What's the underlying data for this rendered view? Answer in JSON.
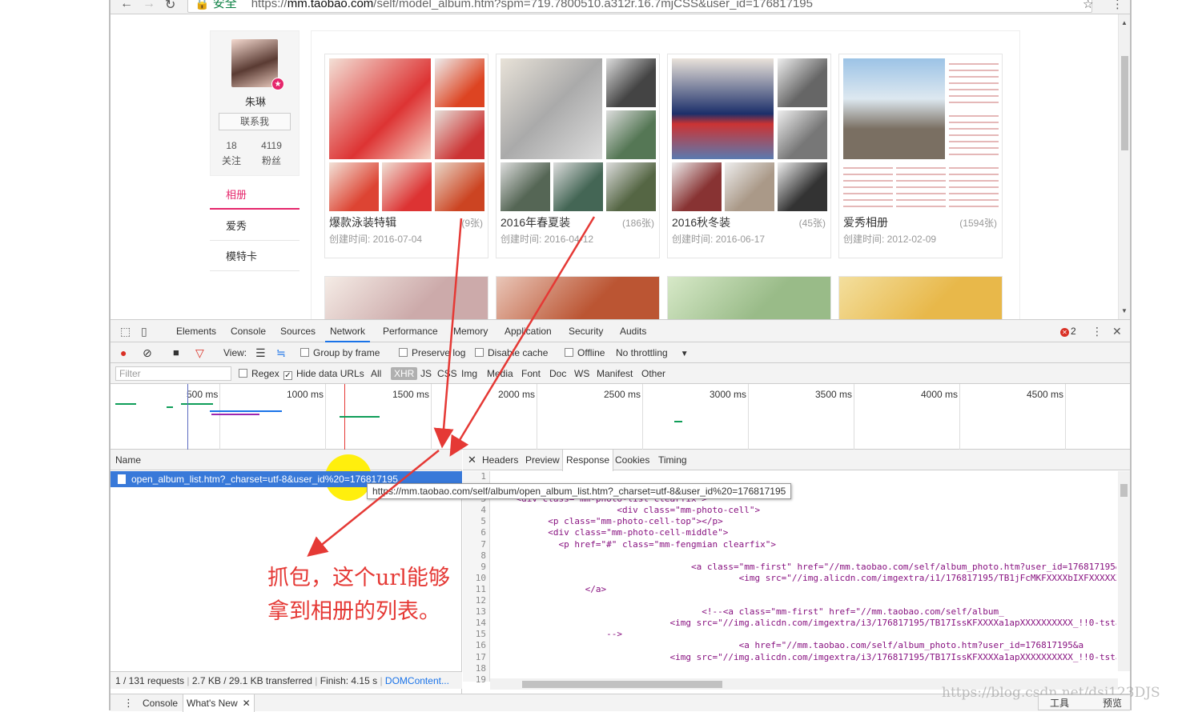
{
  "browser": {
    "url_secure_label": "安全",
    "url_scheme": "https://",
    "url_host": "mm.taobao.com",
    "url_path": "/self/model_album.htm?spm=719.7800510.a312r.16.7mjCSS&user_id=176817195"
  },
  "profile": {
    "name": "朱琳",
    "contact_label": "联系我",
    "following_count": "18",
    "following_label": "关注",
    "fans_count": "4119",
    "fans_label": "粉丝"
  },
  "sidebar": {
    "items": [
      {
        "label": "相册"
      },
      {
        "label": "爱秀"
      },
      {
        "label": "模特卡"
      }
    ]
  },
  "albums": [
    {
      "title": "爆款泳装特辑",
      "count": "(9张)",
      "date": "创建时间: 2016-07-04"
    },
    {
      "title": "2016年春夏装",
      "count": "(186张)",
      "date": "创建时间: 2016-04-12"
    },
    {
      "title": "2016秋冬装",
      "count": "(45张)",
      "date": "创建时间: 2016-06-17"
    },
    {
      "title": "爱秀相册",
      "count": "(1594张)",
      "date": "创建时间: 2012-02-09"
    }
  ],
  "devtools": {
    "tabs": [
      {
        "label": "Elements"
      },
      {
        "label": "Console"
      },
      {
        "label": "Sources"
      },
      {
        "label": "Network"
      },
      {
        "label": "Performance"
      },
      {
        "label": "Memory"
      },
      {
        "label": "Application"
      },
      {
        "label": "Security"
      },
      {
        "label": "Audits"
      }
    ],
    "error_count": "2",
    "toolbar": {
      "view_label": "View:",
      "group_by_frame": "Group by frame",
      "preserve_log": "Preserve log",
      "disable_cache": "Disable cache",
      "offline": "Offline",
      "throttling": "No throttling"
    },
    "filter": {
      "placeholder": "Filter",
      "regex": "Regex",
      "hide_data_urls": "Hide data URLs",
      "types": [
        "All",
        "XHR",
        "JS",
        "CSS",
        "Img",
        "Media",
        "Font",
        "Doc",
        "WS",
        "Manifest",
        "Other"
      ]
    },
    "timeline_ticks": [
      "500 ms",
      "1000 ms",
      "1500 ms",
      "2000 ms",
      "2500 ms",
      "3000 ms",
      "3500 ms",
      "4000 ms",
      "4500 ms"
    ],
    "name_header": "Name",
    "request_name": "open_album_list.htm?_charset=utf-8&user_id%20=176817195",
    "request_name_highlight": "%20=176817195",
    "tooltip": "https://mm.taobao.com/self/album/open_album_list.htm?_charset=utf-8&user_id%20=176817195",
    "status": {
      "requests": "1 / 131 requests",
      "transferred": "2.7 KB / 29.1 KB transferred",
      "finish": "Finish: 4.15 s",
      "dom": "DOMContent..."
    },
    "response_tabs": [
      {
        "label": "Headers"
      },
      {
        "label": "Preview"
      },
      {
        "label": "Response"
      },
      {
        "label": "Cookies"
      },
      {
        "label": "Timing"
      }
    ],
    "line_numbers": [
      "1",
      "2",
      "3",
      "4",
      "5",
      "6",
      "7",
      "8",
      "9",
      "10",
      "11",
      "12",
      "13",
      "14",
      "15",
      "16",
      "17",
      "18",
      "19"
    ],
    "code_lines": [
      "",
      "",
      "    <div class=\"mm-photo-list clearfix\">",
      "                       <div class=\"mm-photo-cell\">",
      "          <p class=\"mm-photo-cell-top\"></p>",
      "          <div class=\"mm-photo-cell-middle\">",
      "            <p href=\"#\" class=\"mm-fengmian clearfix\">",
      "",
      "                                     <a class=\"mm-first\" href=\"//mm.taobao.com/self/album_photo.htm?user_id=176817195&",
      "                                              <img src=\"//img.alicdn.com/imgextra/i1/176817195/TB1jFcMKFXXXXbIXFXXXXXXXX",
      "                 </a>",
      "",
      "                                       <!--<a class=\"mm-first\" href=\"//mm.taobao.com/self/album_",
      "                                 <img src=\"//img.alicdn.com/imgextra/i3/176817195/TB17IssKFXXXXa1apXXXXXXXXXX_!!0-tsta",
      "                     -->",
      "                                              <a href=\"//mm.taobao.com/self/album_photo.htm?user_id=176817195&a",
      "                                 <img src=\"//img.alicdn.com/imgextra/i3/176817195/TB17IssKFXXXXa1apXXXXXXXXXX_!!0-tsta",
      "",
      ""
    ],
    "drawer_tabs": [
      {
        "label": "Console"
      },
      {
        "label": "What's New"
      }
    ]
  },
  "annotation": {
    "line1": "抓包，这个url能够",
    "line2": "拿到相册的列表。"
  },
  "watermark": "https://blog.csdn.net/dsj123DJS",
  "corner": {
    "tools": "工具",
    "preview": "预览"
  }
}
